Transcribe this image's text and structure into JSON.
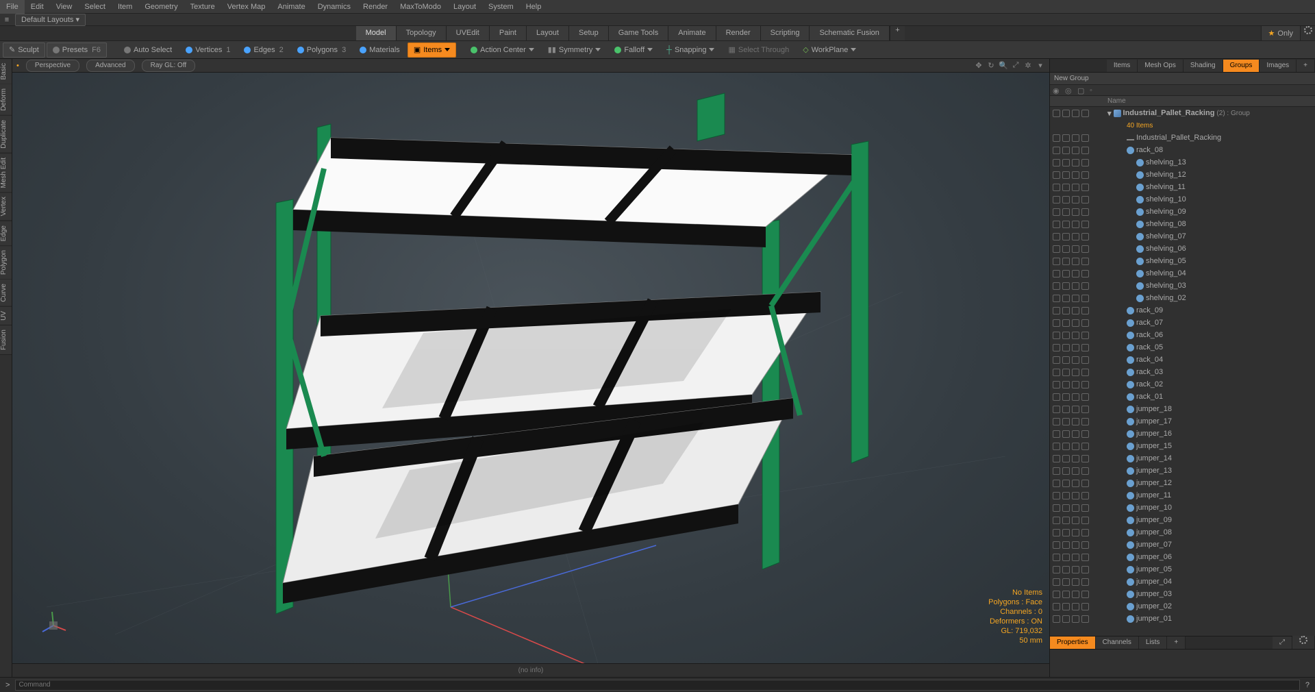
{
  "menu": [
    "File",
    "Edit",
    "View",
    "Select",
    "Item",
    "Geometry",
    "Texture",
    "Vertex Map",
    "Animate",
    "Dynamics",
    "Render",
    "MaxToModo",
    "Layout",
    "System",
    "Help"
  ],
  "layouts_label": "Default Layouts ▾",
  "tabs": [
    "Model",
    "Topology",
    "UVEdit",
    "Paint",
    "Layout",
    "Setup",
    "Game Tools",
    "Animate",
    "Render",
    "Scripting",
    "Schematic Fusion"
  ],
  "active_tab": "Model",
  "only_label": "Only",
  "toolbar": {
    "sculpt": "Sculpt",
    "presets": "Presets",
    "presets_key": "F6",
    "auto_select": "Auto Select",
    "vertices": "Vertices",
    "vertices_key": "1",
    "edges": "Edges",
    "edges_key": "2",
    "polygons": "Polygons",
    "polygons_key": "3",
    "materials": "Materials",
    "items": "Items",
    "action_center": "Action Center",
    "symmetry": "Symmetry",
    "falloff": "Falloff",
    "snapping": "Snapping",
    "select_through": "Select Through",
    "workplane": "WorkPlane"
  },
  "left_tabs": [
    "Basic",
    "Deform",
    "Duplicate",
    "Mesh Edit",
    "Vertex",
    "Edge",
    "Polygon",
    "Curve",
    "UV",
    "Fusion"
  ],
  "vp": {
    "dot": "•",
    "perspective": "Perspective",
    "advanced": "Advanced",
    "raygl": "Ray GL: Off",
    "stats": [
      "No Items",
      "Polygons : Face",
      "Channels : 0",
      "Deformers : ON",
      "GL: 719,032",
      "50 mm"
    ],
    "footer": "(no info)"
  },
  "right": {
    "tabs": [
      "Items",
      "Mesh Ops",
      "Shading",
      "Groups",
      "Images"
    ],
    "active": "Groups",
    "new_group": "New Group",
    "name_hdr": "Name",
    "root": "Industrial_Pallet_Racking",
    "root_suffix": "(2) : Group",
    "count": "40 Items",
    "items": [
      {
        "n": "Industrial_Pallet_Racking",
        "t": "loc",
        "d": 2
      },
      {
        "n": "rack_08",
        "t": "mesh",
        "d": 2
      },
      {
        "n": "shelving_13",
        "t": "mesh",
        "d": 3
      },
      {
        "n": "shelving_12",
        "t": "mesh",
        "d": 3
      },
      {
        "n": "shelving_11",
        "t": "mesh",
        "d": 3
      },
      {
        "n": "shelving_10",
        "t": "mesh",
        "d": 3
      },
      {
        "n": "shelving_09",
        "t": "mesh",
        "d": 3
      },
      {
        "n": "shelving_08",
        "t": "mesh",
        "d": 3
      },
      {
        "n": "shelving_07",
        "t": "mesh",
        "d": 3
      },
      {
        "n": "shelving_06",
        "t": "mesh",
        "d": 3
      },
      {
        "n": "shelving_05",
        "t": "mesh",
        "d": 3
      },
      {
        "n": "shelving_04",
        "t": "mesh",
        "d": 3
      },
      {
        "n": "shelving_03",
        "t": "mesh",
        "d": 3
      },
      {
        "n": "shelving_02",
        "t": "mesh",
        "d": 3
      },
      {
        "n": "rack_09",
        "t": "mesh",
        "d": 2
      },
      {
        "n": "rack_07",
        "t": "mesh",
        "d": 2
      },
      {
        "n": "rack_06",
        "t": "mesh",
        "d": 2
      },
      {
        "n": "rack_05",
        "t": "mesh",
        "d": 2
      },
      {
        "n": "rack_04",
        "t": "mesh",
        "d": 2
      },
      {
        "n": "rack_03",
        "t": "mesh",
        "d": 2
      },
      {
        "n": "rack_02",
        "t": "mesh",
        "d": 2
      },
      {
        "n": "rack_01",
        "t": "mesh",
        "d": 2
      },
      {
        "n": "jumper_18",
        "t": "mesh",
        "d": 2
      },
      {
        "n": "jumper_17",
        "t": "mesh",
        "d": 2
      },
      {
        "n": "jumper_16",
        "t": "mesh",
        "d": 2
      },
      {
        "n": "jumper_15",
        "t": "mesh",
        "d": 2
      },
      {
        "n": "jumper_14",
        "t": "mesh",
        "d": 2
      },
      {
        "n": "jumper_13",
        "t": "mesh",
        "d": 2
      },
      {
        "n": "jumper_12",
        "t": "mesh",
        "d": 2
      },
      {
        "n": "jumper_11",
        "t": "mesh",
        "d": 2
      },
      {
        "n": "jumper_10",
        "t": "mesh",
        "d": 2
      },
      {
        "n": "jumper_09",
        "t": "mesh",
        "d": 2
      },
      {
        "n": "jumper_08",
        "t": "mesh",
        "d": 2
      },
      {
        "n": "jumper_07",
        "t": "mesh",
        "d": 2
      },
      {
        "n": "jumper_06",
        "t": "mesh",
        "d": 2
      },
      {
        "n": "jumper_05",
        "t": "mesh",
        "d": 2
      },
      {
        "n": "jumper_04",
        "t": "mesh",
        "d": 2
      },
      {
        "n": "jumper_03",
        "t": "mesh",
        "d": 2
      },
      {
        "n": "jumper_02",
        "t": "mesh",
        "d": 2
      },
      {
        "n": "jumper_01",
        "t": "mesh",
        "d": 2
      }
    ],
    "prop_tabs": [
      "Properties",
      "Channels",
      "Lists"
    ]
  },
  "cmd": {
    "prompt": ">",
    "placeholder": "Command"
  }
}
